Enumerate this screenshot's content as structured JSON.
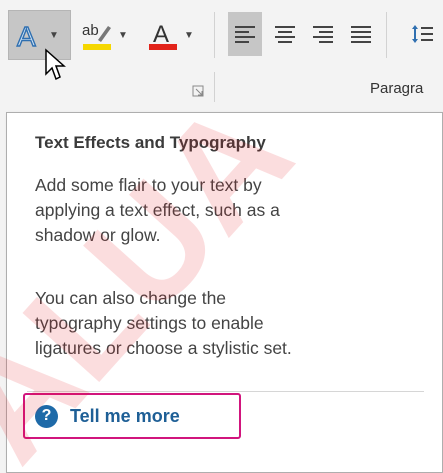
{
  "ribbon": {
    "font_group": {
      "text_effects": {
        "icon": "text-effects-icon",
        "active": true
      },
      "highlight": {
        "icon": "text-highlight-color-icon",
        "glyph": "ab",
        "accent": "#f5d700"
      },
      "font_color": {
        "icon": "font-color-icon",
        "glyph": "A",
        "accent": "#e2231a"
      },
      "launcher_icon": "dialog-launcher-icon"
    },
    "paragraph_group": {
      "label": "Paragra",
      "align_buttons": [
        {
          "name": "align-left",
          "active": true
        },
        {
          "name": "align-center",
          "active": false
        },
        {
          "name": "align-right",
          "active": false
        },
        {
          "name": "justify",
          "active": false
        }
      ],
      "line_spacing_icon": "line-spacing-icon"
    }
  },
  "tooltip": {
    "title": "Text Effects and Typography",
    "description_1": [
      "Add some flair to your text by",
      "applying a text effect, such as a",
      "shadow or glow."
    ],
    "description_2": [
      "You can also change the",
      "typography settings to enable",
      "ligatures or choose a stylistic set."
    ],
    "tell_me_more": "Tell me more",
    "tell_me_more_icon": "help-icon",
    "help_glyph": "?"
  },
  "colors": {
    "highlight_box": "#d1157d",
    "link": "#1e5f96",
    "help_icon": "#1e6aa8",
    "watermark": "#e8161f"
  }
}
